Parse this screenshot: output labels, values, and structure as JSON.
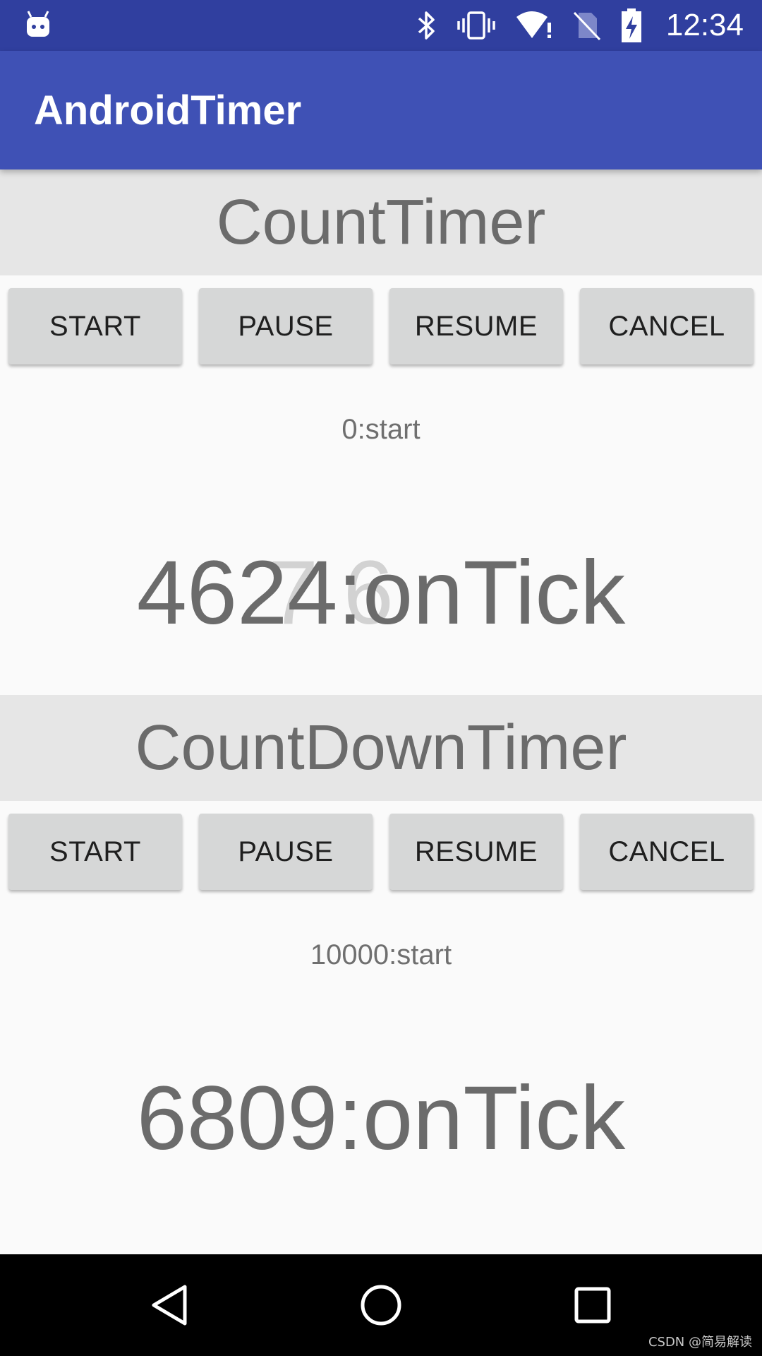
{
  "status_bar": {
    "time": "12:34",
    "icons": [
      "android-robot-icon",
      "bluetooth-icon",
      "vibrate-icon",
      "wifi-alert-icon",
      "no-sim-icon",
      "battery-charging-icon"
    ]
  },
  "app_bar": {
    "title": "AndroidTimer"
  },
  "count_timer": {
    "header": "CountTimer",
    "buttons": {
      "start": "START",
      "pause": "PAUSE",
      "resume": "RESUME",
      "cancel": "CANCEL"
    },
    "status": "0:start",
    "tick": "4624:onTick",
    "ghost_tick": " 7 6     "
  },
  "count_down_timer": {
    "header": "CountDownTimer",
    "buttons": {
      "start": "START",
      "pause": "PAUSE",
      "resume": "RESUME",
      "cancel": "CANCEL"
    },
    "status": "10000:start",
    "tick": "6809:onTick"
  },
  "watermark": "CSDN @简易解读",
  "colors": {
    "status_bar": "#303f9f",
    "app_bar": "#3f51b5",
    "header_bg": "#e6e6e6",
    "button_bg": "#d6d7d7",
    "text_gray": "#6b6b6b"
  }
}
